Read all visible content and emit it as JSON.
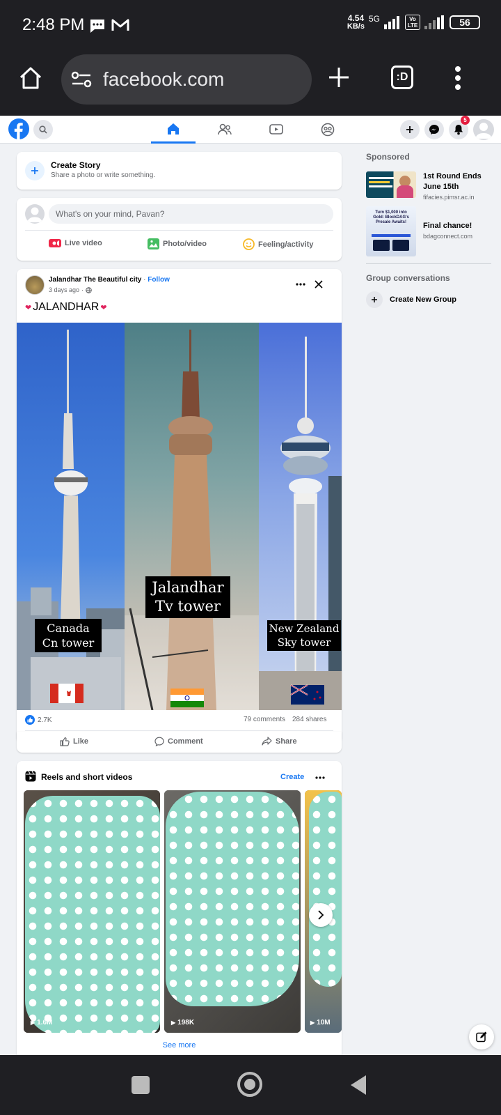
{
  "status": {
    "time": "2:48 PM",
    "net_speed_top": "4.54",
    "net_speed_bottom": "KB/s",
    "network": "5G",
    "volte": "Vo LTE",
    "battery": "56"
  },
  "browser": {
    "url": "facebook.com"
  },
  "header": {
    "notification_count": "5"
  },
  "create_story": {
    "title": "Create Story",
    "subtitle": "Share a photo or write something."
  },
  "composer": {
    "placeholder": "What's on your mind, Pavan?",
    "live_label": "Live video",
    "photo_label": "Photo/video",
    "feeling_label": "Feeling/activity"
  },
  "post": {
    "author": "Jalandhar The Beautiful city",
    "follow": "Follow",
    "time": "3 days ago",
    "text": "JALANDHAR",
    "caption_left_1": "Canada",
    "caption_left_2": "Cn tower",
    "caption_mid_1": "Jalandhar",
    "caption_mid_2": "Tv tower",
    "caption_right_1": "New Zealand",
    "caption_right_2": "Sky tower",
    "reactions": "2.7K",
    "comments": "79 comments",
    "shares": "284 shares",
    "like_label": "Like",
    "comment_label": "Comment",
    "share_label": "Share"
  },
  "reels": {
    "title": "Reels and short videos",
    "create": "Create",
    "items": [
      {
        "views": "1.6M"
      },
      {
        "views": "198K"
      },
      {
        "views": "10M"
      }
    ],
    "see_more": "See more"
  },
  "sidebar": {
    "sponsored_title": "Sponsored",
    "ad1_title": "1st Round Ends June 15th",
    "ad1_domain": "fifacies.pimsr.ac.in",
    "ad2_title": "Final chance!",
    "ad2_domain": "bdagconnect.com",
    "ad2_image_line1": "Turn $1,000 into",
    "ad2_image_line2": "Gold: BlockDAG's",
    "ad2_image_line3": "Presale Awaits!",
    "group_title": "Group conversations",
    "create_group": "Create New Group"
  },
  "colors": {
    "fb_blue": "#1877f2",
    "page_bg": "#f0f2f5",
    "system_bar": "#1f1f23",
    "sticker_teal": "#8fd8c7"
  }
}
